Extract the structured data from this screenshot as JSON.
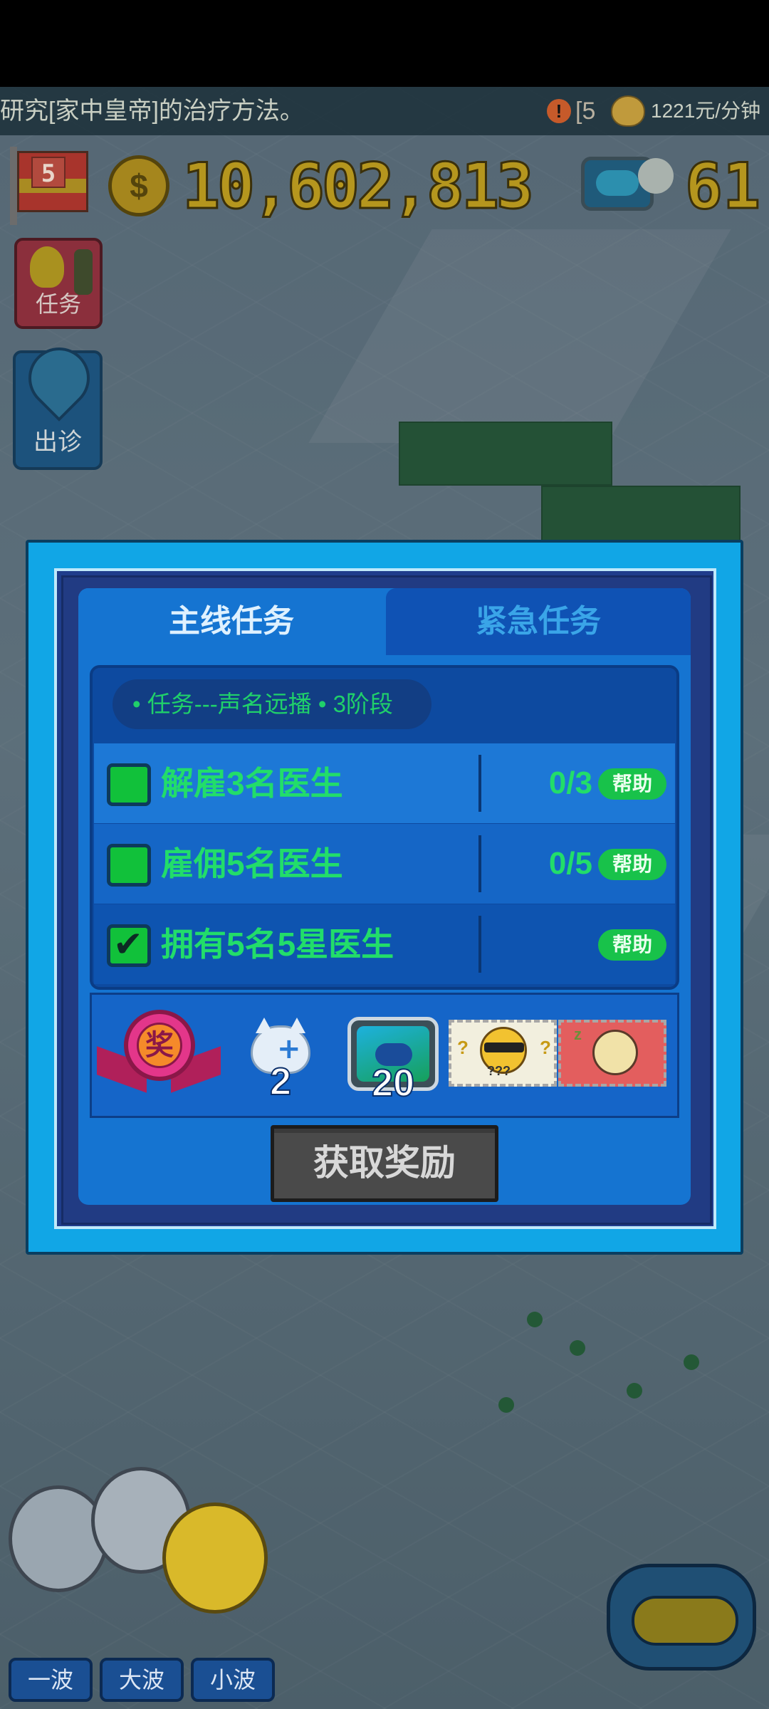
{
  "ticker": {
    "text": "研究[家中皇帝]的治疗方法。",
    "alert_glyph": "!",
    "bracket_text": "[5",
    "rate": "1221元/分钟"
  },
  "hud": {
    "level": "5",
    "coin_glyph": "$",
    "money": "10,602,813",
    "gems": "61"
  },
  "side_buttons": {
    "task": "任务",
    "house_call": "出诊"
  },
  "modal": {
    "tabs": [
      {
        "label": "主线任务",
        "active": true
      },
      {
        "label": "紧急任务",
        "active": false
      }
    ],
    "task_title": "• 任务---声名远播 • 3阶段",
    "tasks": [
      {
        "label": "解雇3名医生",
        "progress": "0/3",
        "done": false,
        "help": "帮助"
      },
      {
        "label": "雇佣5名医生",
        "progress": "0/5",
        "done": false,
        "help": "帮助"
      },
      {
        "label": "拥有5名5星医生",
        "progress": "",
        "done": true,
        "help": "帮助"
      }
    ],
    "rewards": {
      "medal_char": "奖",
      "cat_count": "2",
      "fish_count": "20",
      "mystery_marks": "???"
    },
    "claim_button": "获取奖励"
  },
  "wave_buttons": [
    "一波",
    "大波",
    "小波"
  ],
  "icons": {
    "checkbox_tick": "✔"
  },
  "colors": {
    "task_text": "#22dd6a",
    "help_badge": "#18c24a",
    "active_tab": "#1574d1",
    "inactive_tab": "#0f52b4",
    "modal_border": "#11a6e6",
    "claim_button": "#4a4a4a"
  }
}
